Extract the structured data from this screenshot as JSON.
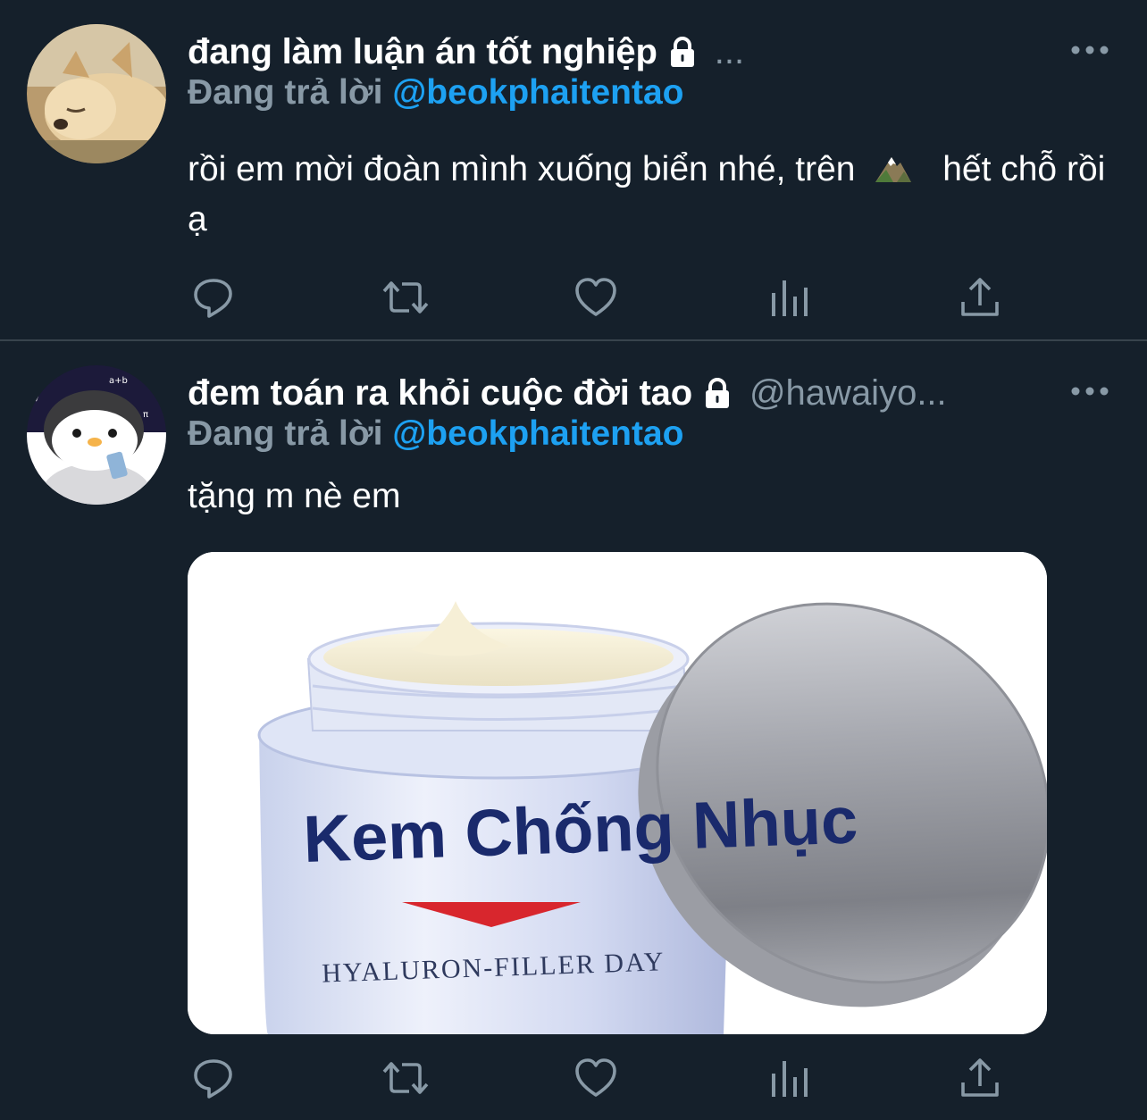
{
  "tweets": [
    {
      "author": {
        "name": "đang làm luận án tốt nghiệp",
        "handle": "...",
        "protected": true
      },
      "replying_label": "Đang trả lời",
      "replying_to": "@beokphaitentao",
      "text_part1": "rồi em mời đoàn mình xuống biển nhé, trên",
      "text_part2": "hết chỗ rồi ạ",
      "avatar_icon": "sleeping-dog-avatar"
    },
    {
      "author": {
        "name": "đem toán ra khỏi cuộc đời tao",
        "handle": "@hawaiyo...",
        "protected": true
      },
      "replying_label": "Đang trả lời",
      "replying_to": "@beokphaitentao",
      "text": "tặng m nè em",
      "avatar_icon": "penguin-avatar",
      "media": {
        "brand": "Kem Chống Nhục",
        "subtitle": "HYALURON-FILLER DAY"
      }
    }
  ],
  "icons": {
    "reply": "reply-icon",
    "retweet": "retweet-icon",
    "like": "like-icon",
    "analytics": "analytics-icon",
    "share": "share-icon",
    "more": "more-icon",
    "lock": "lock-icon",
    "mountain": "mountain-emoji-icon"
  },
  "colors": {
    "background": "#15202b",
    "muted": "#8899a6",
    "accent": "#1da1f2",
    "divider": "#38444d"
  }
}
